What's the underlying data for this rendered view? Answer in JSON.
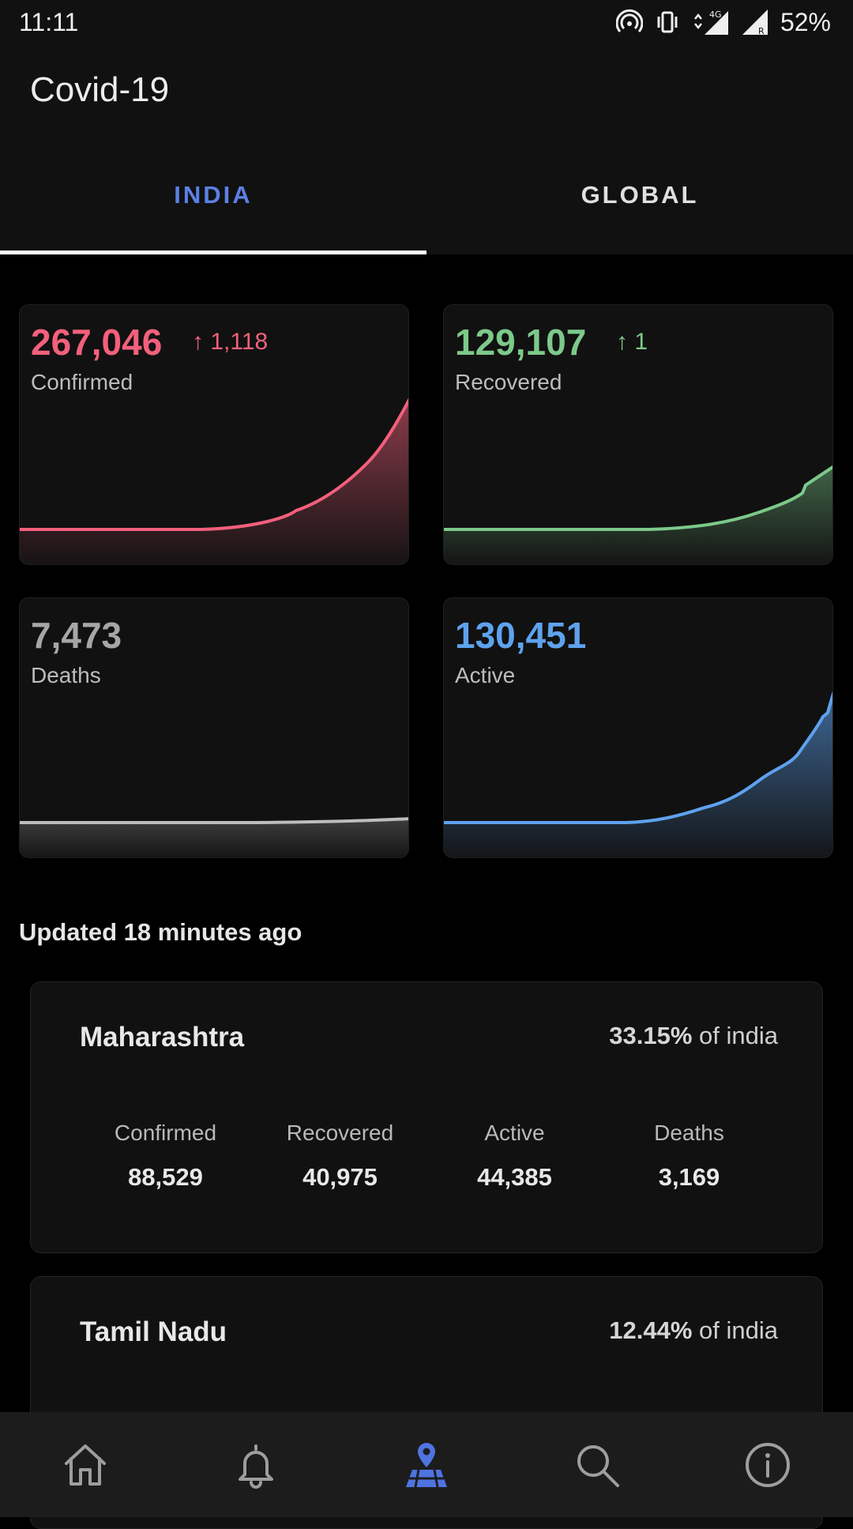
{
  "status_bar": {
    "time": "11:11",
    "network": "4G",
    "roaming": "R",
    "battery": "52%"
  },
  "app": {
    "title": "Covid-19"
  },
  "tabs": [
    {
      "label": "INDIA",
      "active": true
    },
    {
      "label": "GLOBAL",
      "active": false
    }
  ],
  "colors": {
    "accent": "#5b80e6",
    "confirmed": "#f2607c",
    "recovered": "#7cc98a",
    "deaths": "#a6a6a6",
    "active": "#5ea2ee"
  },
  "summary": {
    "confirmed": {
      "value": "267,046",
      "delta": "1,118",
      "label": "Confirmed"
    },
    "recovered": {
      "value": "129,107",
      "delta": "1",
      "label": "Recovered"
    },
    "deaths": {
      "value": "7,473",
      "label": "Deaths"
    },
    "active": {
      "value": "130,451",
      "label": "Active"
    }
  },
  "updated": "Updated 18 minutes ago",
  "states": [
    {
      "name": "Maharashtra",
      "percent": "33.15%",
      "percent_suffix": "of india",
      "stats": [
        {
          "label": "Confirmed",
          "value": "88,529"
        },
        {
          "label": "Recovered",
          "value": "40,975"
        },
        {
          "label": "Active",
          "value": "44,385"
        },
        {
          "label": "Deaths",
          "value": "3,169"
        }
      ]
    },
    {
      "name": "Tamil Nadu",
      "percent": "12.44%",
      "percent_suffix": "of india"
    }
  ],
  "nav": [
    {
      "icon": "home-icon",
      "active": false
    },
    {
      "icon": "bell-icon",
      "active": false
    },
    {
      "icon": "map-pin-icon",
      "active": true
    },
    {
      "icon": "search-icon",
      "active": false
    },
    {
      "icon": "info-icon",
      "active": false
    }
  ]
}
